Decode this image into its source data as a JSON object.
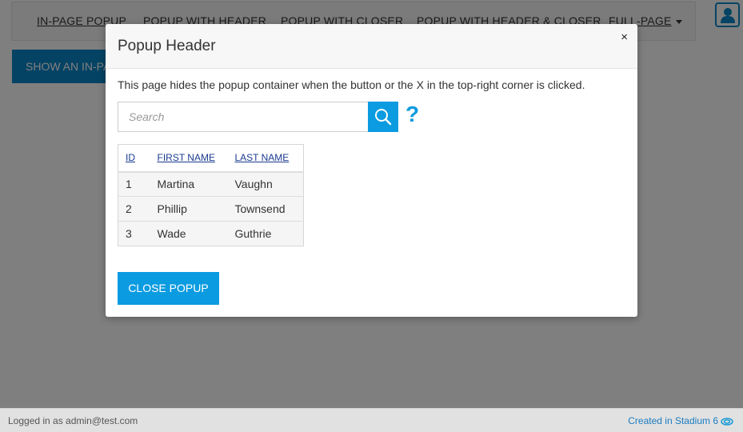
{
  "nav": {
    "items": [
      {
        "label": "IN-PAGE POPUP"
      },
      {
        "label": "POPUP WITH HEADER"
      },
      {
        "label": "POPUP WITH CLOSER"
      },
      {
        "label": "POPUP WITH HEADER & CLOSER"
      },
      {
        "label": "FULL-PAGE"
      }
    ]
  },
  "main": {
    "show_button_label": "SHOW AN IN-PAGE POPUP"
  },
  "popup": {
    "title": "Popup Header",
    "close_symbol": "×",
    "description": "This page hides the popup container when the button or the X in the top-right corner is clicked.",
    "search": {
      "placeholder": "Search",
      "value": ""
    },
    "help_symbol": "?",
    "table": {
      "columns": [
        "ID",
        "FIRST NAME",
        "LAST NAME"
      ],
      "rows": [
        {
          "id": "1",
          "first": "Martina",
          "last": "Vaughn"
        },
        {
          "id": "2",
          "first": "Phillip",
          "last": "Townsend"
        },
        {
          "id": "3",
          "first": "Wade",
          "last": "Guthrie"
        }
      ]
    },
    "close_button_label": "CLOSE POPUP"
  },
  "footer": {
    "logged_in": "Logged in as admin@test.com",
    "created": "Created in Stadium 6"
  },
  "colors": {
    "accent": "#0b9be0",
    "nav_blue": "#0b87c9",
    "link": "#1a3b8f"
  },
  "icons": {
    "user": "user-icon",
    "search": "search-icon",
    "stadium": "stadium-logo-icon",
    "dropdown": "caret-down-icon"
  }
}
